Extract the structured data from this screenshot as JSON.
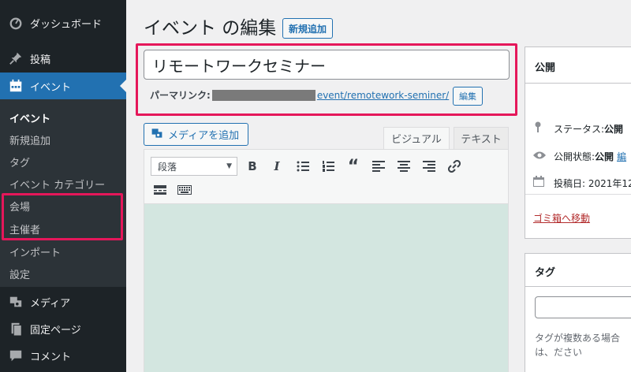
{
  "sidebar": {
    "items": [
      {
        "label": "ダッシュボード",
        "icon": "dashboard-icon"
      },
      {
        "label": "投稿",
        "icon": "pin-icon"
      },
      {
        "label": "イベント",
        "icon": "calendar-icon"
      },
      {
        "label": "メディア",
        "icon": "media-icon"
      },
      {
        "label": "固定ページ",
        "icon": "page-icon"
      },
      {
        "label": "コメント",
        "icon": "comment-icon"
      }
    ],
    "submenu": [
      "イベント",
      "新規追加",
      "タグ",
      "イベント カテゴリー",
      "会場",
      "主催者",
      "インポート",
      "設定"
    ]
  },
  "header": {
    "title": "イベント の編集",
    "add_new_label": "新規追加"
  },
  "post": {
    "title": "リモートワークセミナー",
    "permalink_label": "パーマリンク:",
    "permalink_url": "event/remotework-seminer/",
    "permalink_edit_label": "編集"
  },
  "editor": {
    "add_media_label": "メディアを追加",
    "tabs": [
      "ビジュアル",
      "テキスト"
    ],
    "format_value": "段落"
  },
  "publish": {
    "title": "公開",
    "status_label": "ステータス:",
    "status_value": "公開",
    "visibility_label": "公開状態:",
    "visibility_value": "公開",
    "visibility_link": "編",
    "date_label": "投稿日: 2021年12",
    "trash_label": "ゴミ箱へ移動"
  },
  "tags": {
    "title": "タグ",
    "help": "タグが複数ある場合は、ださい"
  },
  "colors": {
    "sidebar_bg": "#1d2327",
    "accent": "#2271b1",
    "highlight": "#e5175a",
    "editor_bg": "#d3e6e0"
  }
}
